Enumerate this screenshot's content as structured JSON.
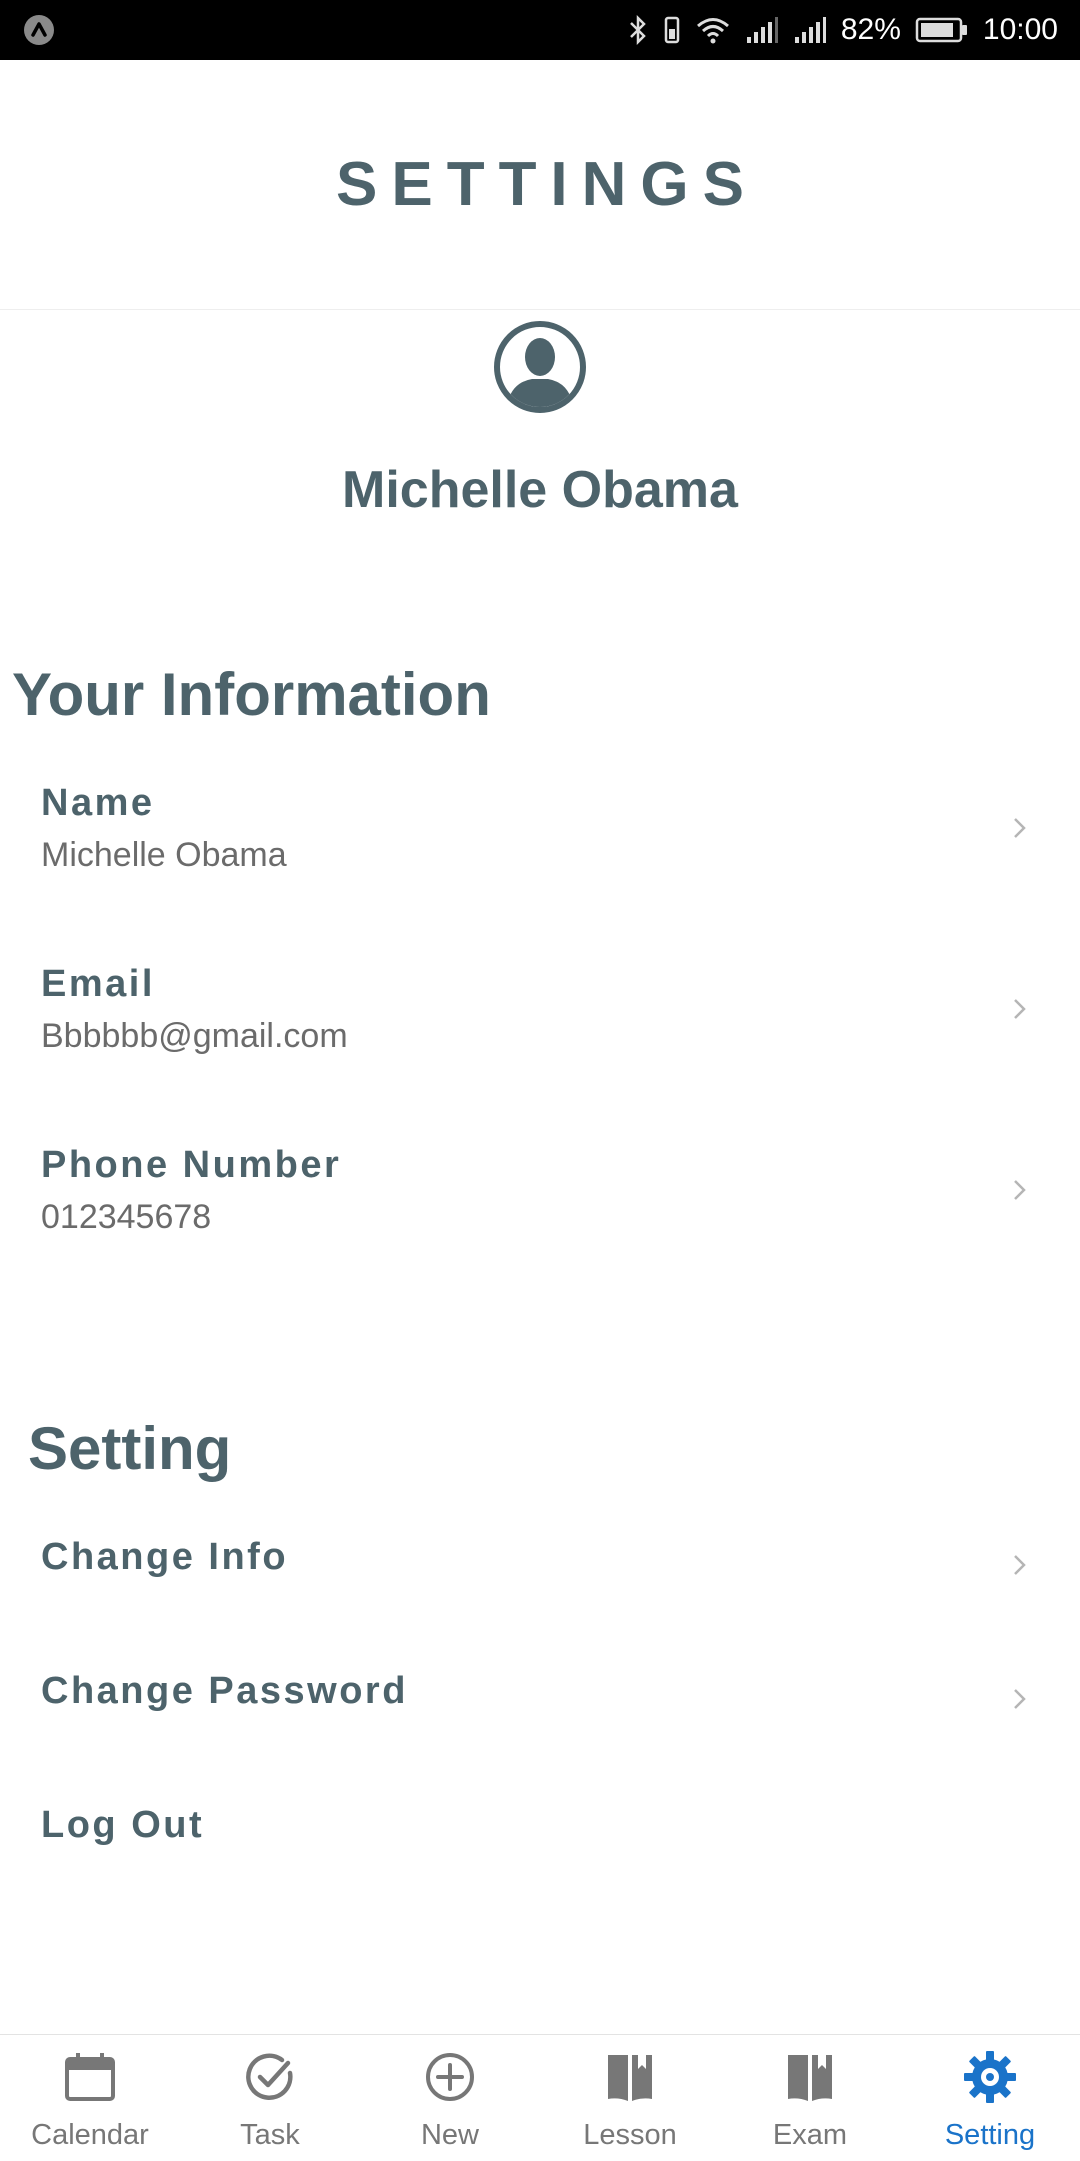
{
  "status_bar": {
    "battery_percent": "82%",
    "time": "10:00",
    "icons": [
      "notification-icon",
      "bluetooth-icon",
      "vibrate-icon",
      "wifi-icon",
      "signal-icon",
      "signal-icon",
      "battery-icon"
    ]
  },
  "header": {
    "title": "SETTINGS"
  },
  "profile": {
    "name": "Michelle Obama",
    "avatar_icon": "user-avatar-icon"
  },
  "your_information": {
    "title": "Your Information",
    "items": [
      {
        "label": "Name",
        "value": "Michelle Obama"
      },
      {
        "label": "Email",
        "value": "Bbbbbb@gmail.com"
      },
      {
        "label": "Phone Number",
        "value": "012345678"
      }
    ]
  },
  "setting": {
    "title": "Setting",
    "items": [
      {
        "label": "Change Info"
      },
      {
        "label": "Change Password"
      },
      {
        "label": "Log Out"
      }
    ]
  },
  "bottom_nav": {
    "items": [
      {
        "label": "Calendar",
        "icon": "calendar-icon"
      },
      {
        "label": "Task",
        "icon": "check-circle-icon"
      },
      {
        "label": "New",
        "icon": "plus-circle-icon"
      },
      {
        "label": "Lesson",
        "icon": "book-icon"
      },
      {
        "label": "Exam",
        "icon": "book-icon"
      },
      {
        "label": "Setting",
        "icon": "gear-icon"
      }
    ],
    "active": "Setting"
  },
  "colors": {
    "primary_text": "#4d636b",
    "secondary_text": "#6b6b6b",
    "nav_inactive": "#777777",
    "nav_active": "#1a73c9",
    "status_bar_bg": "#000000"
  }
}
